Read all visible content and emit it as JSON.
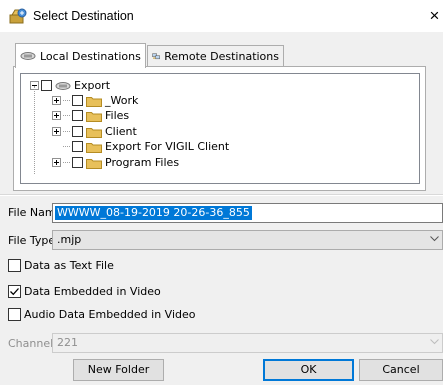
{
  "window": {
    "title": "Select Destination",
    "close_glyph": "×",
    "icon": "select-destination-icon"
  },
  "tabs": [
    {
      "label": "Local Destinations",
      "icon": "local-drive-icon",
      "active": true
    },
    {
      "label": "Remote Destinations",
      "icon": "network-icon",
      "active": false
    }
  ],
  "tree": {
    "items": [
      {
        "label": "Export",
        "expander": "minus",
        "checked": false,
        "icon": "drive-icon"
      },
      {
        "label": "_Work",
        "expander": "plus",
        "checked": false,
        "icon": "folder-icon"
      },
      {
        "label": "Files",
        "expander": "plus",
        "checked": false,
        "icon": "folder-icon"
      },
      {
        "label": "Client",
        "expander": "plus",
        "checked": false,
        "icon": "folder-icon"
      },
      {
        "label": "Export For VIGIL Client",
        "expander": "none",
        "checked": false,
        "icon": "folder-icon"
      },
      {
        "label": "Program Files",
        "expander": "plus",
        "checked": false,
        "icon": "folder-icon"
      }
    ]
  },
  "form": {
    "file_name_label": "File Name:",
    "file_name_value": "WWWW_08-19-2019 20-26-36_855",
    "file_type_label": "File Type:",
    "file_type_value": ".mjp",
    "options": [
      {
        "label": "Data as Text File",
        "checked": false
      },
      {
        "label": "Data Embedded in Video",
        "checked": true
      },
      {
        "label": "Audio Data Embedded in Video",
        "checked": false
      }
    ],
    "channel_label": "Channel:",
    "channel_value": "221"
  },
  "buttons": {
    "new_folder": "New Folder",
    "ok": "OK",
    "cancel": "Cancel"
  },
  "colors": {
    "selection": "#0078d7",
    "folder": "#e8c05a"
  }
}
